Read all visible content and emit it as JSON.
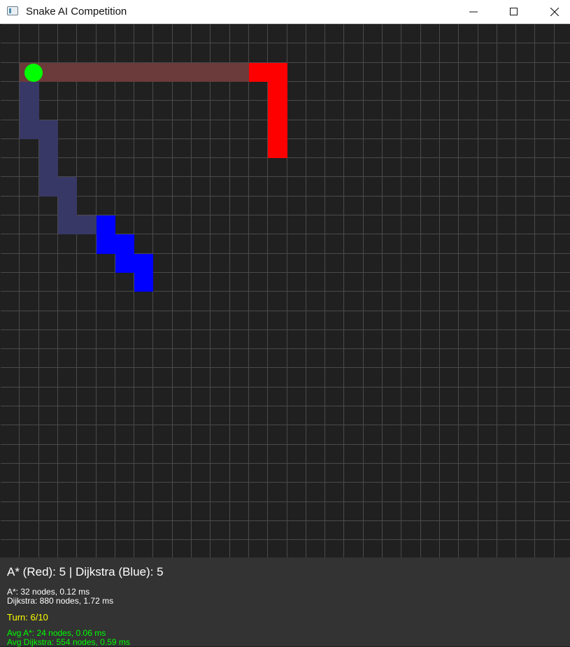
{
  "window": {
    "title": "Snake AI Competition",
    "icons": {
      "app": "app-icon",
      "minimize": "minimize-icon",
      "maximize": "maximize-icon",
      "close": "close-icon"
    }
  },
  "game": {
    "colors": {
      "background": "#202020",
      "grid": "#4a4a4a",
      "red_snake": "#ff0000",
      "red_trail": "#6b3a3a",
      "blue_snake": "#0000ff",
      "blue_trail": "#383866",
      "food": "#00ff00"
    }
  },
  "status": {
    "score": "A* (Red): 5 | Dijkstra (Blue): 5",
    "astar_stats": "A*: 32 nodes, 0.12 ms",
    "dijkstra_stats": "Dijkstra: 880 nodes, 1.72 ms",
    "turn": "Turn: 6/10",
    "avg_astar": "Avg A*: 24 nodes, 0.06 ms",
    "avg_dijkstra": "Avg Dijkstra: 554 nodes, 0.59 ms"
  }
}
